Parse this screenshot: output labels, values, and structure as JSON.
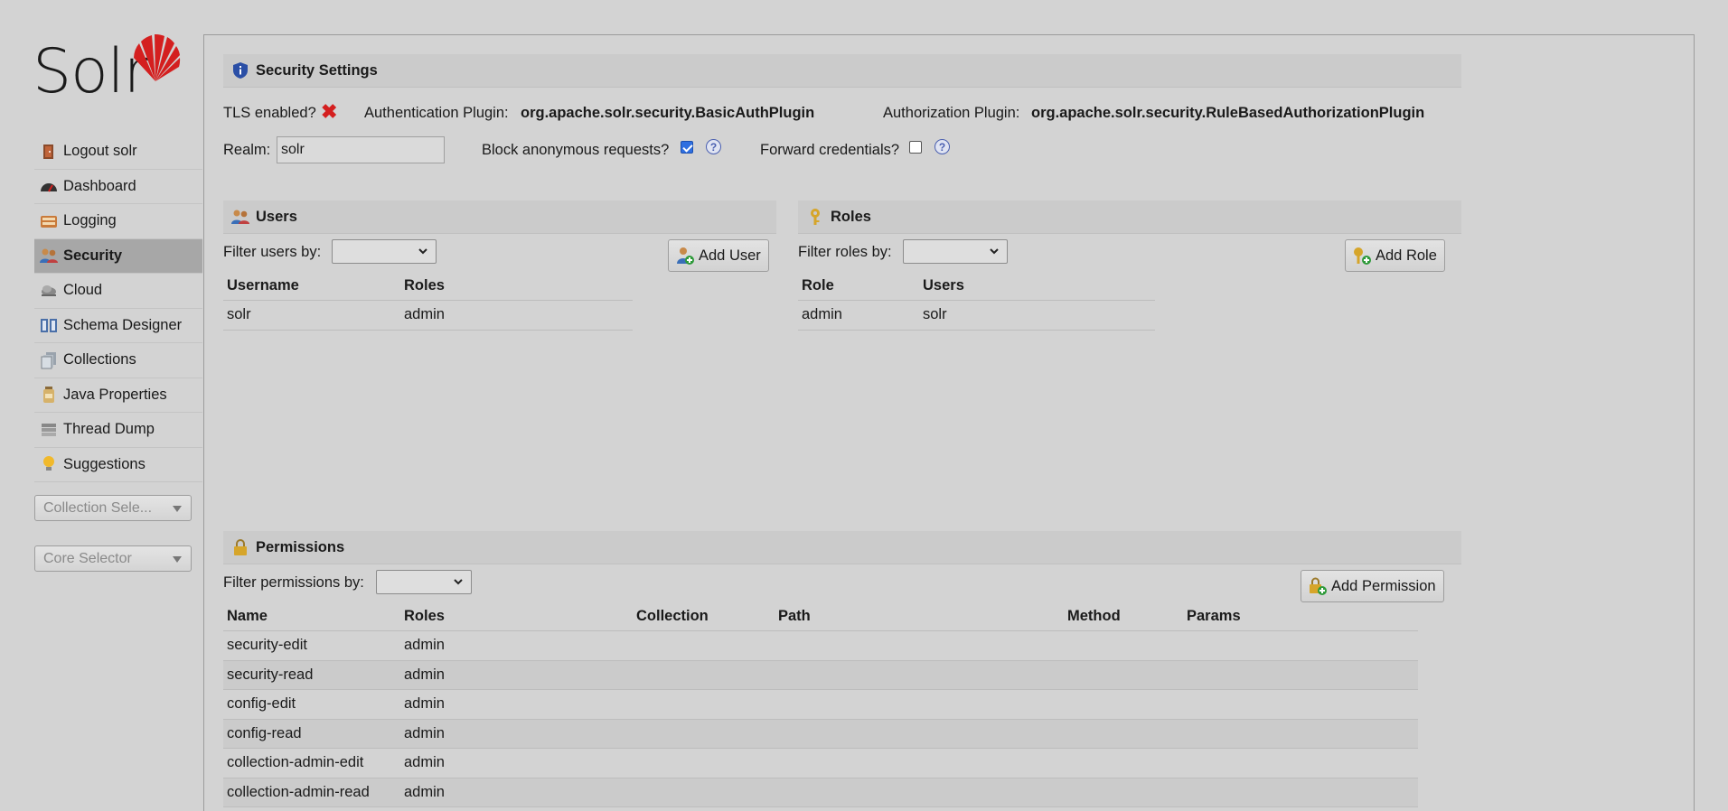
{
  "brand": {
    "logo_text": "Solr"
  },
  "sidebar": {
    "items": [
      {
        "label": "Logout solr",
        "icon": "logout-door-icon",
        "active": false
      },
      {
        "label": "Dashboard",
        "icon": "dashboard-icon",
        "active": false
      },
      {
        "label": "Logging",
        "icon": "logging-icon",
        "active": false
      },
      {
        "label": "Security",
        "icon": "users-icon",
        "active": true
      },
      {
        "label": "Cloud",
        "icon": "cloud-icon",
        "active": false
      },
      {
        "label": "Schema Designer",
        "icon": "book-icon",
        "active": false
      },
      {
        "label": "Collections",
        "icon": "collections-icon",
        "active": false
      },
      {
        "label": "Java Properties",
        "icon": "jar-icon",
        "active": false
      },
      {
        "label": "Thread Dump",
        "icon": "stack-icon",
        "active": false
      },
      {
        "label": "Suggestions",
        "icon": "lightbulb-icon",
        "active": false
      }
    ],
    "collection_selector": "Collection Sele...",
    "core_selector": "Core Selector"
  },
  "security": {
    "title": "Security Settings",
    "tls_label": "TLS enabled?",
    "auth_plugin_label": "Authentication Plugin:",
    "auth_plugin_value": "org.apache.solr.security.BasicAuthPlugin",
    "authz_plugin_label": "Authorization Plugin:",
    "authz_plugin_value": "org.apache.solr.security.RuleBasedAuthorizationPlugin",
    "realm_label": "Realm:",
    "realm_value": "solr",
    "block_anon_label": "Block anonymous requests?",
    "block_anon_checked": true,
    "forward_cred_label": "Forward credentials?",
    "forward_cred_checked": false,
    "help_glyph": "?"
  },
  "users": {
    "title": "Users",
    "filter_label": "Filter users by:",
    "add_button": "Add User",
    "columns": [
      "Username",
      "Roles"
    ],
    "rows": [
      [
        "solr",
        "admin"
      ]
    ]
  },
  "roles": {
    "title": "Roles",
    "filter_label": "Filter roles by:",
    "add_button": "Add Role",
    "columns": [
      "Role",
      "Users"
    ],
    "rows": [
      [
        "admin",
        "solr"
      ]
    ]
  },
  "permissions": {
    "title": "Permissions",
    "filter_label": "Filter permissions by:",
    "add_button": "Add Permission",
    "columns": [
      "Name",
      "Roles",
      "Collection",
      "Path",
      "Method",
      "Params"
    ],
    "rows": [
      [
        "security-edit",
        "admin",
        "",
        "",
        "",
        ""
      ],
      [
        "security-read",
        "admin",
        "",
        "",
        "",
        ""
      ],
      [
        "config-edit",
        "admin",
        "",
        "",
        "",
        ""
      ],
      [
        "config-read",
        "admin",
        "",
        "",
        "",
        ""
      ],
      [
        "collection-admin-edit",
        "admin",
        "",
        "",
        "",
        ""
      ],
      [
        "collection-admin-read",
        "admin",
        "",
        "",
        "",
        ""
      ]
    ]
  },
  "colors": {
    "accent_red": "#d41f1f",
    "active_bg": "#a7a7a7",
    "checkbox_blue": "#2f6fe0"
  }
}
